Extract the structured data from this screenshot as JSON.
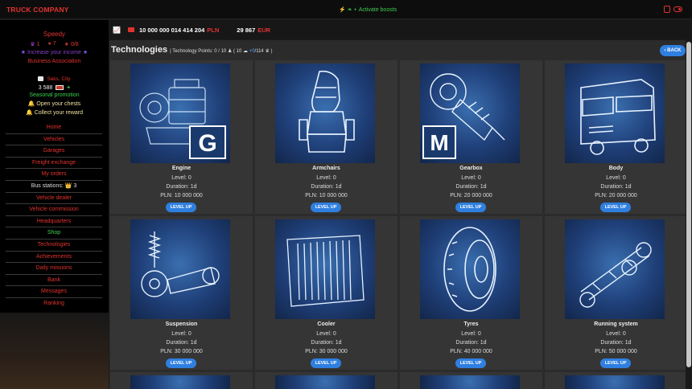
{
  "app": {
    "brand": "TRUCK COMPANY",
    "boosts_label": "Activate boosts"
  },
  "sidebar": {
    "user": "Speedy",
    "stats": [
      "1",
      "7",
      "0/8"
    ],
    "income_link": "Increase your income",
    "association": "Business Association",
    "city": "Seks. City",
    "money": "3 588",
    "promo": "Seasonal promotion",
    "chests": "Open your chests",
    "reward": "Collect your reward",
    "nav": [
      {
        "label": "Home"
      },
      {
        "label": "Vehicles"
      },
      {
        "label": "Garages"
      },
      {
        "label": "Freight exchange"
      },
      {
        "label": "My orders"
      },
      {
        "label": "Bus stations: 👑 3"
      },
      {
        "label": "Vehicle dealer"
      },
      {
        "label": "Vehicle commission"
      },
      {
        "label": "Headquarters"
      },
      {
        "label": "Shop"
      },
      {
        "label": "Technologies"
      },
      {
        "label": "Achievements"
      },
      {
        "label": "Daily missions"
      },
      {
        "label": "Bank"
      },
      {
        "label": "Messages"
      },
      {
        "label": "Ranking"
      }
    ]
  },
  "currency": {
    "amount_pln": "10 000 000 014 414 204",
    "pln": "PLN",
    "amount_eur": "29 867",
    "eur": "EUR"
  },
  "page": {
    "title": "Technologies",
    "tech_points": "| Technology Points: 0 / 10",
    "tp_extra1": "( 10",
    "tp_blue": "+0",
    "tp_extra2": "/114",
    "tp_close": ")",
    "back": "BACK"
  },
  "cards": [
    {
      "name": "Engine",
      "level": "Level: 0",
      "duration": "Duration: 1d",
      "price": "PLN: 10 000 000",
      "button": "LEVEL UP",
      "icon": "engine-icon"
    },
    {
      "name": "Armchairs",
      "level": "Level: 0",
      "duration": "Duration: 1d",
      "price": "PLN: 10 000 000",
      "button": "LEVEL UP",
      "icon": "seat-icon"
    },
    {
      "name": "Gearbox",
      "level": "Level: 0",
      "duration": "Duration: 1d",
      "price": "PLN: 20 000 000",
      "button": "LEVEL UP",
      "icon": "gearbox-icon"
    },
    {
      "name": "Body",
      "level": "Level: 0",
      "duration": "Duration: 1d",
      "price": "PLN: 20 000 000",
      "button": "LEVEL UP",
      "icon": "truck-cab-icon"
    },
    {
      "name": "Suspension",
      "level": "Level: 0",
      "duration": "Duration: 1d",
      "price": "PLN: 30 000 000",
      "button": "LEVEL UP",
      "icon": "suspension-icon"
    },
    {
      "name": "Cooler",
      "level": "Level: 0",
      "duration": "Duration: 1d",
      "price": "PLN: 30 000 000",
      "button": "LEVEL UP",
      "icon": "radiator-icon"
    },
    {
      "name": "Tyres",
      "level": "Level: 0",
      "duration": "Duration: 1d",
      "price": "PLN: 40 000 000",
      "button": "LEVEL UP",
      "icon": "tyre-icon"
    },
    {
      "name": "Running system",
      "level": "Level: 0",
      "duration": "Duration: 1d",
      "price": "PLN: 50 000 000",
      "button": "LEVEL UP",
      "icon": "chassis-icon"
    }
  ],
  "badges": {
    "engine": "G",
    "gearbox": "M"
  }
}
